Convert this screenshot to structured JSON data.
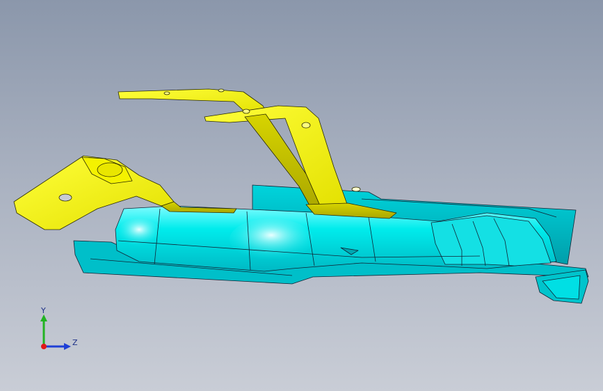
{
  "viewport": {
    "background_top": "#8b97ab",
    "background_bottom": "#c9cdd6"
  },
  "model": {
    "bracket_color": "#e8e800",
    "body_color": "#00e8e8"
  },
  "triad": {
    "y_label": "Y",
    "z_label": "Z",
    "y_color": "#22b322",
    "z_color": "#1f3fd6",
    "x_color": "#e01818"
  }
}
